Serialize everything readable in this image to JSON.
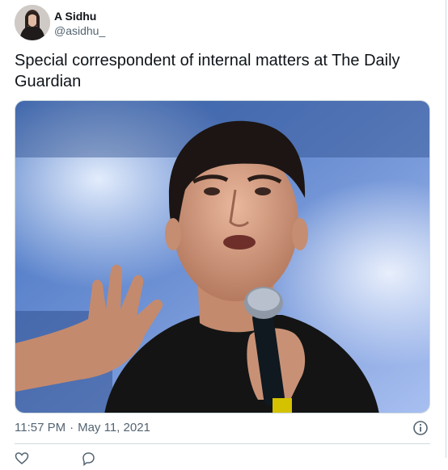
{
  "author": {
    "display_name": "A Sidhu",
    "handle": "@asidhu_"
  },
  "tweet": {
    "text": "Special correspondent of internal matters at The Daily Guardian",
    "time": "11:57 PM",
    "separator": "·",
    "date": "May 11, 2021"
  },
  "icons": {
    "info": "info-icon",
    "like": "heart-icon",
    "reply": "reply-icon"
  },
  "colors": {
    "text": "#0f1419",
    "secondary": "#536471",
    "border": "#cfd9de"
  }
}
